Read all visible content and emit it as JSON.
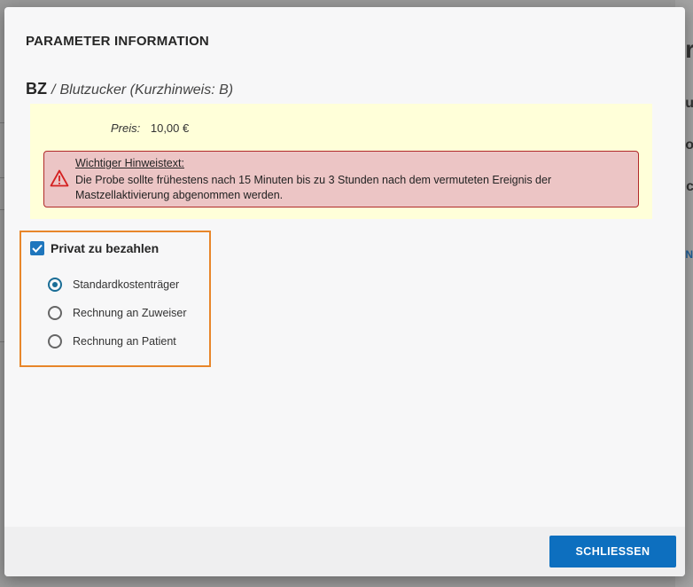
{
  "background": {
    "fragments": [
      "r",
      "u",
      "o",
      "c",
      "N"
    ]
  },
  "modal": {
    "title": "PARAMETER INFORMATION",
    "parameter": {
      "code": "BZ",
      "separator": "/",
      "name": "Blutzucker (Kurzhinweis: B)"
    },
    "price": {
      "label": "Preis:",
      "value": "10,00 €"
    },
    "warning": {
      "icon": "warning-triangle-icon",
      "title": "Wichtiger Hinweistext:",
      "text": "Die Probe sollte frühestens nach 15 Minuten bis zu 3 Stunden nach dem vermuteten Ereignis der Mastzellaktivierung abgenommen werden."
    },
    "payment": {
      "checkbox_label": "Privat zu bezahlen",
      "checked": true,
      "options": [
        {
          "label": "Standardkostenträger",
          "selected": true
        },
        {
          "label": "Rechnung an Zuweiser",
          "selected": false
        },
        {
          "label": "Rechnung an Patient",
          "selected": false
        }
      ]
    },
    "footer": {
      "close_label": "SCHLIESSEN"
    }
  },
  "colors": {
    "accent": "#0d6fbf",
    "focus_outline": "#e8862a",
    "warning_bg": "#ecc5c5",
    "warning_border": "#b02a2a",
    "info_bg": "#ffffd9"
  }
}
